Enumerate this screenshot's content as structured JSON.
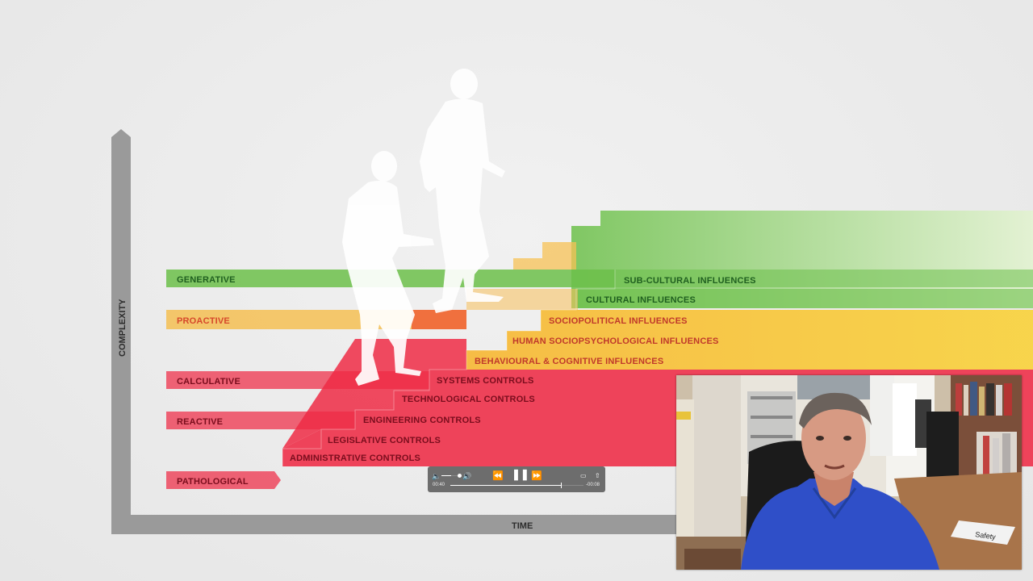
{
  "axis": {
    "y_label": "COMPLEXITY",
    "x_label": "TIME"
  },
  "levels": [
    "GENERATIVE",
    "PROACTIVE",
    "CALCULATIVE",
    "REACTIVE",
    "PATHOLOGICAL"
  ],
  "red_steps": [
    "ADMINISTRATIVE CONTROLS",
    "LEGISLATIVE CONTROLS",
    "ENGINEERING CONTROLS",
    "TECHNOLOGICAL CONTROLS",
    "SYSTEMS CONTROLS"
  ],
  "yellow_steps": [
    "BEHAVIOURAL & COGNITIVE INFLUENCES",
    "HUMAN SOCIOPSYCHOLOGICAL INFLUENCES",
    "SOCIOPOLITICAL INFLUENCES"
  ],
  "green_steps": [
    "CULTURAL INFLUENCES",
    "SUB-CULTURAL INFLUENCES"
  ],
  "colors": {
    "red": "#ee2b45",
    "yellow": "#f7b733",
    "green": "#6cc04a",
    "axis": "#9a9a9a"
  },
  "player": {
    "elapsed": "00:40",
    "remaining": "-00:08",
    "progress": 0.83,
    "volume": 0.55,
    "state": "playing"
  },
  "webcam": {
    "signboard_text": "Safety"
  }
}
